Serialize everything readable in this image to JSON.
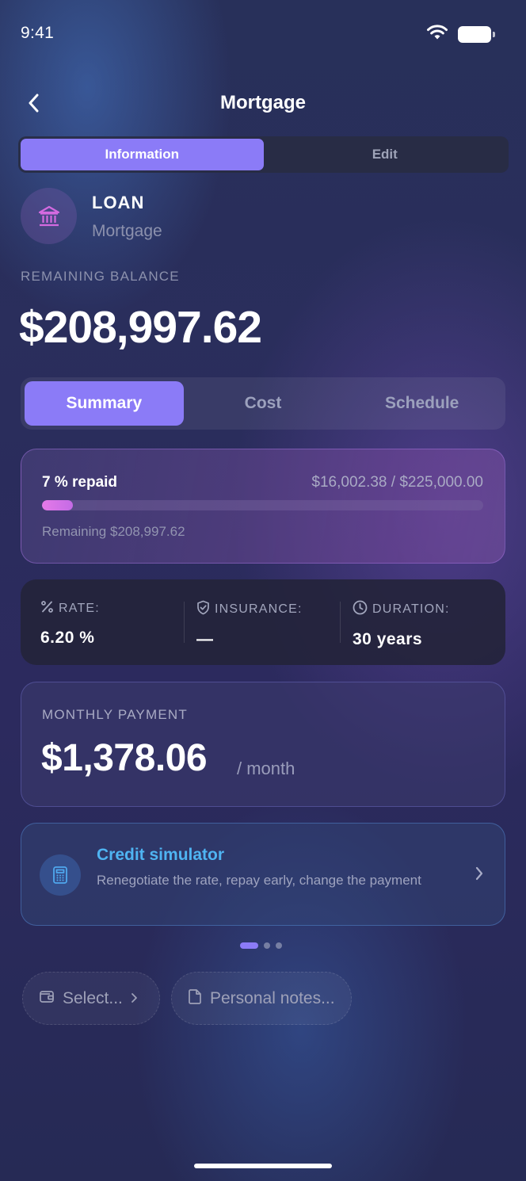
{
  "status_bar": {
    "time": "9:41"
  },
  "header": {
    "title": "Mortgage"
  },
  "top_tabs": [
    {
      "label": "Information",
      "active": true
    },
    {
      "label": "Edit",
      "active": false
    }
  ],
  "loan": {
    "type": "LOAN",
    "name": "Mortgage",
    "icon": "bank-icon"
  },
  "balance": {
    "label": "REMAINING BALANCE",
    "value": "$208,997.62"
  },
  "section_tabs": [
    {
      "label": "Summary",
      "active": true
    },
    {
      "label": "Cost",
      "active": false
    },
    {
      "label": "Schedule",
      "active": false
    }
  ],
  "progress": {
    "percent_label": "7 % repaid",
    "amounts": "$16,002.38 / $225,000.00",
    "fraction": 0.07,
    "remaining_label": "Remaining $208,997.62"
  },
  "stats": {
    "rate": {
      "label": "RATE:",
      "value": "6.20 %",
      "icon": "percent-icon"
    },
    "insurance": {
      "label": "INSURANCE:",
      "value": "—",
      "icon": "shield-icon"
    },
    "duration": {
      "label": "DURATION:",
      "value": "30 years",
      "icon": "clock-icon"
    }
  },
  "monthly": {
    "label": "MONTHLY PAYMENT",
    "value": "$1,378.06",
    "unit": "/ month"
  },
  "simulator": {
    "title": "Credit simulator",
    "description": "Renegotiate the rate, repay early, change the payment",
    "icon": "calculator-icon"
  },
  "pager": {
    "count": 3,
    "active": 0
  },
  "chips": {
    "select": "Select...",
    "notes": "Personal notes..."
  },
  "colors": {
    "accent": "#8b7bf7",
    "progress": "#e57ae8",
    "link": "#4fb4f2"
  }
}
